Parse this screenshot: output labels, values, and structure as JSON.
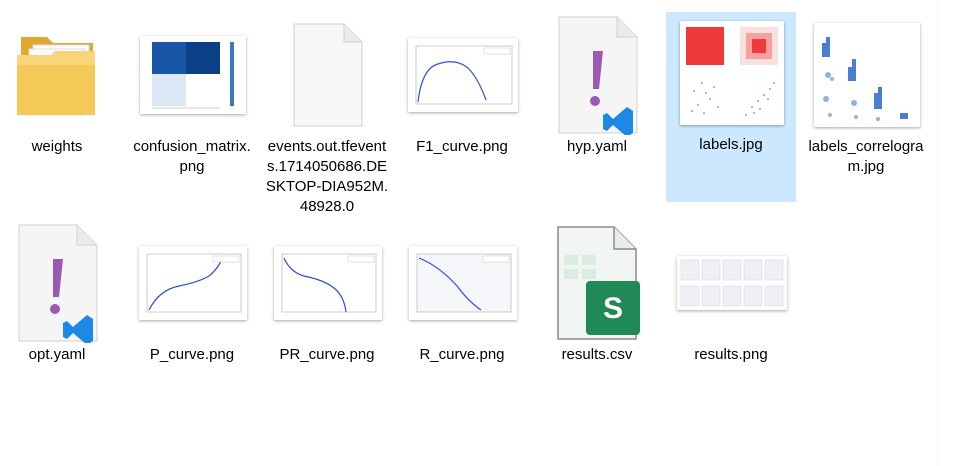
{
  "files": [
    {
      "name": "weights",
      "type": "folder",
      "icon": "folder-icon"
    },
    {
      "name": "confusion_matrix.png",
      "type": "image",
      "icon": "image-thumbnail"
    },
    {
      "name": "events.out.tfevents.1714050686.DESKTOP-DIA952M.48928.0",
      "type": "file",
      "icon": "blank-file-icon"
    },
    {
      "name": "F1_curve.png",
      "type": "image",
      "icon": "image-thumbnail"
    },
    {
      "name": "hyp.yaml",
      "type": "yaml",
      "icon": "yaml-file-icon"
    },
    {
      "name": "labels.jpg",
      "type": "image",
      "icon": "image-thumbnail",
      "selected": true
    },
    {
      "name": "labels_correlogram.jpg",
      "type": "image",
      "icon": "image-thumbnail"
    },
    {
      "name": "opt.yaml",
      "type": "yaml",
      "icon": "yaml-file-icon"
    },
    {
      "name": "P_curve.png",
      "type": "image",
      "icon": "image-thumbnail"
    },
    {
      "name": "PR_curve.png",
      "type": "image",
      "icon": "image-thumbnail"
    },
    {
      "name": "R_curve.png",
      "type": "image",
      "icon": "image-thumbnail"
    },
    {
      "name": "results.csv",
      "type": "csv",
      "icon": "excel-file-icon"
    },
    {
      "name": "results.png",
      "type": "image",
      "icon": "image-thumbnail"
    }
  ],
  "colors": {
    "selection": "#cce8ff",
    "folder": "#f3c34a",
    "vscode_blue": "#1e88e5",
    "yaml_purple": "#9b59b6",
    "excel_green": "#1f8a55",
    "plot_blue": "#2b4fd6"
  }
}
